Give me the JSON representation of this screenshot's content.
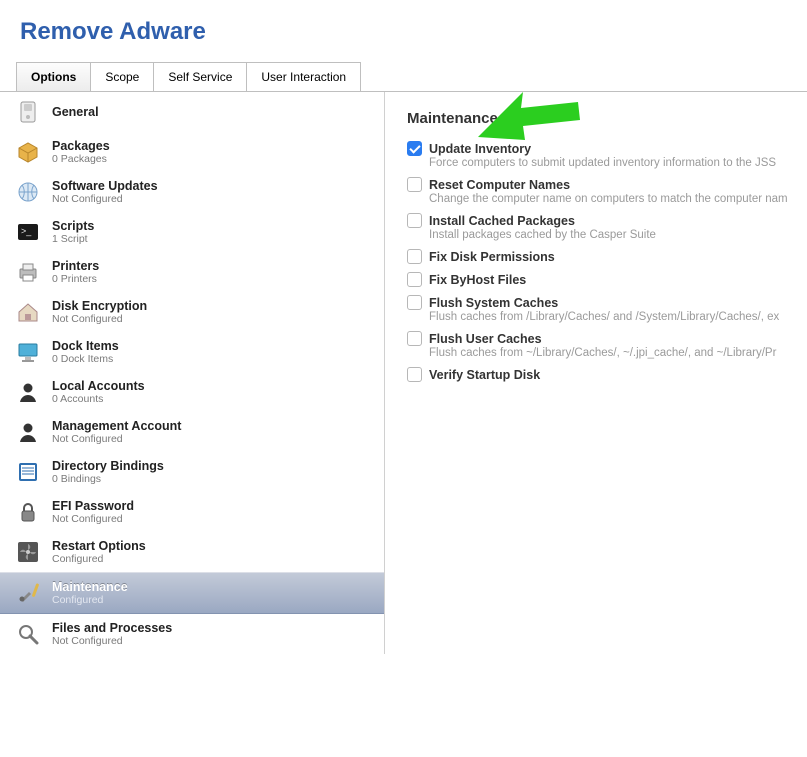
{
  "title": "Remove Adware",
  "tabs": [
    {
      "label": "Options",
      "active": true
    },
    {
      "label": "Scope",
      "active": false
    },
    {
      "label": "Self Service",
      "active": false
    },
    {
      "label": "User Interaction",
      "active": false
    }
  ],
  "sidebar": [
    {
      "key": "general",
      "label": "General",
      "sub": "",
      "icon": "switch-icon"
    },
    {
      "key": "packages",
      "label": "Packages",
      "sub": "0 Packages",
      "icon": "package-icon"
    },
    {
      "key": "software-updates",
      "label": "Software Updates",
      "sub": "Not Configured",
      "icon": "globe-icon"
    },
    {
      "key": "scripts",
      "label": "Scripts",
      "sub": "1 Script",
      "icon": "terminal-icon"
    },
    {
      "key": "printers",
      "label": "Printers",
      "sub": "0 Printers",
      "icon": "printer-icon"
    },
    {
      "key": "disk-encryption",
      "label": "Disk Encryption",
      "sub": "Not Configured",
      "icon": "house-lock-icon"
    },
    {
      "key": "dock-items",
      "label": "Dock Items",
      "sub": "0 Dock Items",
      "icon": "monitor-icon"
    },
    {
      "key": "local-accounts",
      "label": "Local Accounts",
      "sub": "0 Accounts",
      "icon": "person-icon"
    },
    {
      "key": "management-account",
      "label": "Management Account",
      "sub": "Not Configured",
      "icon": "person-icon"
    },
    {
      "key": "directory-bindings",
      "label": "Directory Bindings",
      "sub": "0 Bindings",
      "icon": "book-icon"
    },
    {
      "key": "efi-password",
      "label": "EFI Password",
      "sub": "Not Configured",
      "icon": "lock-icon"
    },
    {
      "key": "restart-options",
      "label": "Restart Options",
      "sub": "Configured",
      "icon": "fan-icon"
    },
    {
      "key": "maintenance",
      "label": "Maintenance",
      "sub": "Configured",
      "icon": "tools-icon",
      "selected": true
    },
    {
      "key": "files-processes",
      "label": "Files and Processes",
      "sub": "Not Configured",
      "icon": "magnifier-icon"
    }
  ],
  "panel": {
    "title": "Maintenance",
    "options": [
      {
        "label": "Update Inventory",
        "desc": "Force computers to submit updated inventory information to the JSS",
        "checked": true
      },
      {
        "label": "Reset Computer Names",
        "desc": "Change the computer name on computers to match the computer nam",
        "checked": false
      },
      {
        "label": "Install Cached Packages",
        "desc": "Install packages cached by the Casper Suite",
        "checked": false
      },
      {
        "label": "Fix Disk Permissions",
        "desc": "",
        "checked": false
      },
      {
        "label": "Fix ByHost Files",
        "desc": "",
        "checked": false
      },
      {
        "label": "Flush System Caches",
        "desc": "Flush caches from /Library/Caches/ and /System/Library/Caches/, ex",
        "checked": false
      },
      {
        "label": "Flush User Caches",
        "desc": "Flush caches from ~/Library/Caches/, ~/.jpi_cache/, and ~/Library/Pr",
        "checked": false
      },
      {
        "label": "Verify Startup Disk",
        "desc": "",
        "checked": false
      }
    ]
  },
  "annotation_color": "#2bce1f"
}
